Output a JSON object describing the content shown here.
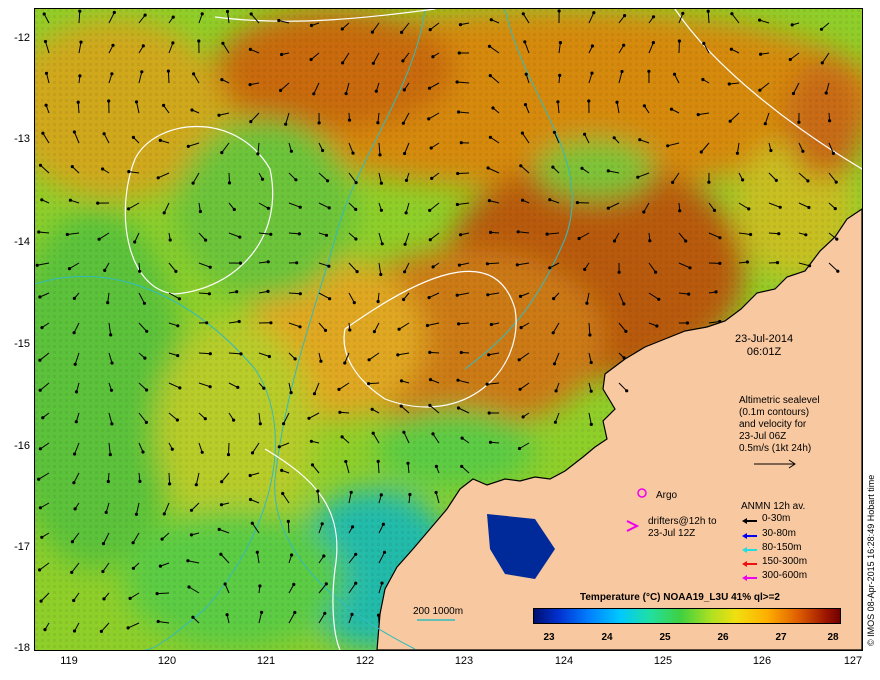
{
  "map": {
    "y_ticks": [
      "-12",
      "-13",
      "-14",
      "-15",
      "-16",
      "-17",
      "-18"
    ],
    "x_ticks": [
      "119",
      "120",
      "121",
      "122",
      "123",
      "124",
      "125",
      "126",
      "127"
    ],
    "lat_range": [
      -18,
      -11.75
    ],
    "lon_range": [
      118.65,
      127
    ]
  },
  "annotations": {
    "date_line1": "23-Jul-2014",
    "date_line2": "06:01Z",
    "info_lines": [
      "Altimetric sealevel",
      "(0.1m contours)",
      "and velocity for",
      "23-Jul 06Z",
      "0.5m/s (1kt 24h)"
    ],
    "argo_label": "Argo",
    "drifters_line1": "drifters@12h to",
    "drifters_line2": "23-Jul 12Z",
    "anmn_title": "ANMN 12h av.",
    "depth_contours": "200  1000m",
    "credit": "© IMOS 08-Apr-2015 16:28:49 Hobart time"
  },
  "legend": [
    {
      "label": "0-30m",
      "color": "#000000"
    },
    {
      "label": "30-80m",
      "color": "#0000ee"
    },
    {
      "label": "80-150m",
      "color": "#22dddd"
    },
    {
      "label": "150-300m",
      "color": "#ee1111"
    },
    {
      "label": "300-600m",
      "color": "#ee00ee"
    }
  ],
  "colorbar": {
    "title": "Temperature (°C) NOAA19_L3U 41% ql>=2",
    "ticks": [
      "23",
      "24",
      "25",
      "26",
      "27",
      "28"
    ],
    "min": 22.8,
    "max": 28.0
  },
  "colors": {
    "land": "#f8c8a0",
    "warm": "#c86400",
    "cool": "#33cc33",
    "isobath": "#33bbbb"
  }
}
